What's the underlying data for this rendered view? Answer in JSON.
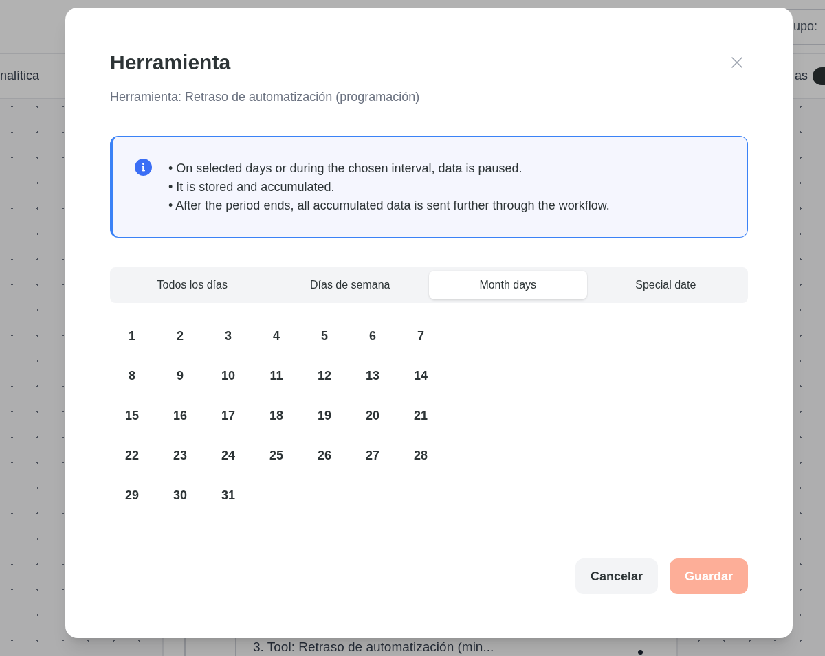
{
  "page": {
    "header_field": "upo:",
    "nav_tab": "nalítica",
    "toggle": {
      "label": "as",
      "on": true
    },
    "node": {
      "title": "3. Tool: Retraso de automatización (min..."
    }
  },
  "dialog": {
    "title": "Herramienta",
    "subtitle": "Herramienta: Retraso de automatización (programación)",
    "info": [
      "• On selected days or during the chosen interval, data is paused.",
      "• It is stored and accumulated.",
      "• After the period ends, all accumulated data is sent further through the workflow."
    ],
    "tabs": [
      {
        "label": "Todos los días",
        "selected": false
      },
      {
        "label": "Días de semana",
        "selected": false
      },
      {
        "label": "Month days",
        "selected": true
      },
      {
        "label": "Special date",
        "selected": false
      }
    ],
    "days": [
      {
        "label": "1",
        "selected": false
      },
      {
        "label": "2",
        "selected": false
      },
      {
        "label": "3",
        "selected": false
      },
      {
        "label": "4",
        "selected": false
      },
      {
        "label": "5",
        "selected": false
      },
      {
        "label": "6",
        "selected": false
      },
      {
        "label": "7",
        "selected": false
      },
      {
        "label": "8",
        "selected": false
      },
      {
        "label": "9",
        "selected": false
      },
      {
        "label": "10",
        "selected": false
      },
      {
        "label": "11",
        "selected": false
      },
      {
        "label": "12",
        "selected": false
      },
      {
        "label": "13",
        "selected": false
      },
      {
        "label": "14",
        "selected": false
      },
      {
        "label": "15",
        "selected": false
      },
      {
        "label": "16",
        "selected": false
      },
      {
        "label": "17",
        "selected": false
      },
      {
        "label": "18",
        "selected": false
      },
      {
        "label": "19",
        "selected": false
      },
      {
        "label": "20",
        "selected": false
      },
      {
        "label": "21",
        "selected": false
      },
      {
        "label": "22",
        "selected": false
      },
      {
        "label": "23",
        "selected": false
      },
      {
        "label": "24",
        "selected": false
      },
      {
        "label": "25",
        "selected": false
      },
      {
        "label": "26",
        "selected": false
      },
      {
        "label": "27",
        "selected": false
      },
      {
        "label": "28",
        "selected": false
      },
      {
        "label": "29",
        "selected": false
      },
      {
        "label": "30",
        "selected": false
      },
      {
        "label": "31",
        "selected": false
      }
    ],
    "buttons": [
      {
        "label": "Cancelar",
        "kind": "secondary",
        "disabled": false
      },
      {
        "label": "Guardar",
        "kind": "primary",
        "disabled": true
      }
    ]
  }
}
